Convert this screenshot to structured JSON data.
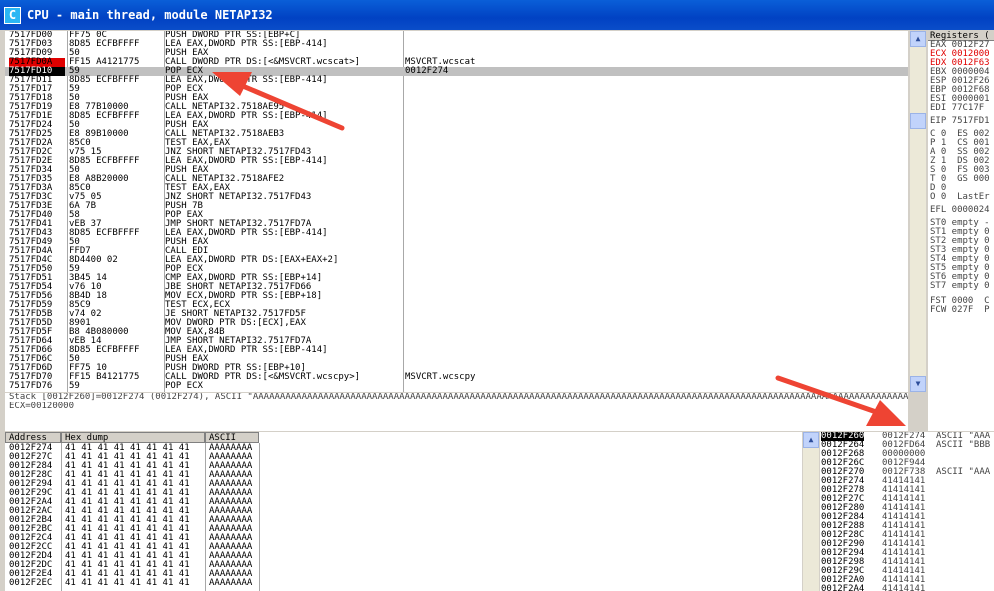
{
  "window": {
    "title": "CPU - main thread, module NETAPI32",
    "icon_letter": "C"
  },
  "cpu_rows": [
    {
      "addr": "7517FD00",
      "hex": "FF75 0C",
      "dis": "PUSH DWORD PTR SS:[EBP+C]",
      "com": ""
    },
    {
      "addr": "7517FD03",
      "hex": "8D85 ECFBFFFF",
      "dis": "LEA EAX,DWORD PTR SS:[EBP-414]",
      "com": ""
    },
    {
      "addr": "7517FD09",
      "hex": "50",
      "dis": "PUSH EAX",
      "com": ""
    },
    {
      "addr": "7517FD0A",
      "hex": "FF15 A4121775",
      "dis": "CALL DWORD PTR DS:[<&MSVCRT.wcscat>]",
      "com": "MSVCRT.wcscat",
      "state": "bp"
    },
    {
      "addr": "7517FD10",
      "hex": "59",
      "dis": "POP ECX",
      "com": "0012F274",
      "state": "cur"
    },
    {
      "addr": "7517FD11",
      "hex": "8D85 ECFBFFFF",
      "dis": "LEA EAX,DWORD PTR SS:[EBP-414]",
      "com": ""
    },
    {
      "addr": "7517FD17",
      "hex": "59",
      "dis": "POP ECX",
      "com": ""
    },
    {
      "addr": "7517FD18",
      "hex": "50",
      "dis": "PUSH EAX",
      "com": ""
    },
    {
      "addr": "7517FD19",
      "hex": "E8 77B10000",
      "dis": "CALL NETAPI32.7518AE95",
      "com": ""
    },
    {
      "addr": "7517FD1E",
      "hex": "8D85 ECFBFFFF",
      "dis": "LEA EAX,DWORD PTR SS:[EBP-414]",
      "com": ""
    },
    {
      "addr": "7517FD24",
      "hex": "50",
      "dis": "PUSH EAX",
      "com": ""
    },
    {
      "addr": "7517FD25",
      "hex": "E8 89B10000",
      "dis": "CALL NETAPI32.7518AEB3",
      "com": ""
    },
    {
      "addr": "7517FD2A",
      "hex": "85C0",
      "dis": "TEST EAX,EAX",
      "com": ""
    },
    {
      "addr": "7517FD2C",
      "hex": "v75 15",
      "dis": "JNZ SHORT NETAPI32.7517FD43",
      "com": ""
    },
    {
      "addr": "7517FD2E",
      "hex": "8D85 ECFBFFFF",
      "dis": "LEA EAX,DWORD PTR SS:[EBP-414]",
      "com": ""
    },
    {
      "addr": "7517FD34",
      "hex": "50",
      "dis": "PUSH EAX",
      "com": ""
    },
    {
      "addr": "7517FD35",
      "hex": "E8 A8B20000",
      "dis": "CALL NETAPI32.7518AFE2",
      "com": ""
    },
    {
      "addr": "7517FD3A",
      "hex": "85C0",
      "dis": "TEST EAX,EAX",
      "com": ""
    },
    {
      "addr": "7517FD3C",
      "hex": "v75 05",
      "dis": "JNZ SHORT NETAPI32.7517FD43",
      "com": ""
    },
    {
      "addr": "7517FD3E",
      "hex": "6A 7B",
      "dis": "PUSH 7B",
      "com": ""
    },
    {
      "addr": "7517FD40",
      "hex": "58",
      "dis": "POP EAX",
      "com": ""
    },
    {
      "addr": "7517FD41",
      "hex": "vEB 37",
      "dis": "JMP SHORT NETAPI32.7517FD7A",
      "com": ""
    },
    {
      "addr": "7517FD43",
      "hex": "8D85 ECFBFFFF",
      "dis": "LEA EAX,DWORD PTR SS:[EBP-414]",
      "com": ""
    },
    {
      "addr": "7517FD49",
      "hex": "50",
      "dis": "PUSH EAX",
      "com": ""
    },
    {
      "addr": "7517FD4A",
      "hex": "FFD7",
      "dis": "CALL EDI",
      "com": ""
    },
    {
      "addr": "7517FD4C",
      "hex": "8D4400 02",
      "dis": "LEA EAX,DWORD PTR DS:[EAX+EAX+2]",
      "com": ""
    },
    {
      "addr": "7517FD50",
      "hex": "59",
      "dis": "POP ECX",
      "com": ""
    },
    {
      "addr": "7517FD51",
      "hex": "3B45 14",
      "dis": "CMP EAX,DWORD PTR SS:[EBP+14]",
      "com": ""
    },
    {
      "addr": "7517FD54",
      "hex": "v76 10",
      "dis": "JBE SHORT NETAPI32.7517FD66",
      "com": ""
    },
    {
      "addr": "7517FD56",
      "hex": "8B4D 18",
      "dis": "MOV ECX,DWORD PTR SS:[EBP+18]",
      "com": ""
    },
    {
      "addr": "7517FD59",
      "hex": "85C9",
      "dis": "TEST ECX,ECX",
      "com": ""
    },
    {
      "addr": "7517FD5B",
      "hex": "v74 02",
      "dis": "JE SHORT NETAPI32.7517FD5F",
      "com": ""
    },
    {
      "addr": "7517FD5D",
      "hex": "8901",
      "dis": "MOV DWORD PTR DS:[ECX],EAX",
      "com": ""
    },
    {
      "addr": "7517FD5F",
      "hex": "B8 4B080000",
      "dis": "MOV EAX,84B",
      "com": ""
    },
    {
      "addr": "7517FD64",
      "hex": "vEB 14",
      "dis": "JMP SHORT NETAPI32.7517FD7A",
      "com": ""
    },
    {
      "addr": "7517FD66",
      "hex": "8D85 ECFBFFFF",
      "dis": "LEA EAX,DWORD PTR SS:[EBP-414]",
      "com": ""
    },
    {
      "addr": "7517FD6C",
      "hex": "50",
      "dis": "PUSH EAX",
      "com": ""
    },
    {
      "addr": "7517FD6D",
      "hex": "FF75 10",
      "dis": "PUSH DWORD PTR SS:[EBP+10]",
      "com": ""
    },
    {
      "addr": "7517FD70",
      "hex": "FF15 B4121775",
      "dis": "CALL DWORD PTR DS:[<&MSVCRT.wcscpy>]",
      "com": "MSVCRT.wcscpy"
    },
    {
      "addr": "7517FD76",
      "hex": "59",
      "dis": "POP ECX",
      "com": ""
    }
  ],
  "info": {
    "line1": "Stack [0012F260]=0012F274 (0012F274), ASCII \"AAAAAAAAAAAAAAAAAAAAAAAAAAAAAAAAAAAAAAAAAAAAAAAAAAAAAAAAAAAAAAAAAAAAAAAAAAAAAAAAAAAAAAAAAAAAAAAAAAAAAAAAAAAAAAAAAAAAAAAAAAAAAAAAAAAA",
    "line2": "ECX=00120000"
  },
  "dump": {
    "headers": {
      "address": "Address",
      "hex": "Hex dump",
      "ascii": "ASCII"
    },
    "rows": [
      {
        "addr": "0012F274",
        "hex": "41 41 41 41 41 41 41 41",
        "ascii": "AAAAAAAA"
      },
      {
        "addr": "0012F27C",
        "hex": "41 41 41 41 41 41 41 41",
        "ascii": "AAAAAAAA"
      },
      {
        "addr": "0012F284",
        "hex": "41 41 41 41 41 41 41 41",
        "ascii": "AAAAAAAA"
      },
      {
        "addr": "0012F28C",
        "hex": "41 41 41 41 41 41 41 41",
        "ascii": "AAAAAAAA"
      },
      {
        "addr": "0012F294",
        "hex": "41 41 41 41 41 41 41 41",
        "ascii": "AAAAAAAA"
      },
      {
        "addr": "0012F29C",
        "hex": "41 41 41 41 41 41 41 41",
        "ascii": "AAAAAAAA"
      },
      {
        "addr": "0012F2A4",
        "hex": "41 41 41 41 41 41 41 41",
        "ascii": "AAAAAAAA"
      },
      {
        "addr": "0012F2AC",
        "hex": "41 41 41 41 41 41 41 41",
        "ascii": "AAAAAAAA"
      },
      {
        "addr": "0012F2B4",
        "hex": "41 41 41 41 41 41 41 41",
        "ascii": "AAAAAAAA"
      },
      {
        "addr": "0012F2BC",
        "hex": "41 41 41 41 41 41 41 41",
        "ascii": "AAAAAAAA"
      },
      {
        "addr": "0012F2C4",
        "hex": "41 41 41 41 41 41 41 41",
        "ascii": "AAAAAAAA"
      },
      {
        "addr": "0012F2CC",
        "hex": "41 41 41 41 41 41 41 41",
        "ascii": "AAAAAAAA"
      },
      {
        "addr": "0012F2D4",
        "hex": "41 41 41 41 41 41 41 41",
        "ascii": "AAAAAAAA"
      },
      {
        "addr": "0012F2DC",
        "hex": "41 41 41 41 41 41 41 41",
        "ascii": "AAAAAAAA"
      },
      {
        "addr": "0012F2E4",
        "hex": "41 41 41 41 41 41 41 41",
        "ascii": "AAAAAAAA"
      },
      {
        "addr": "0012F2EC",
        "hex": "41 41 41 41 41 41 41 41",
        "ascii": "AAAAAAAA"
      }
    ]
  },
  "stack_rows": [
    {
      "addr": "0012F260",
      "val": "0012F274",
      "com": "ASCII \"AAA"
    },
    {
      "addr": "0012F264",
      "val": "0012FD64",
      "com": "ASCII \"BBB"
    },
    {
      "addr": "0012F268",
      "val": "00000000",
      "com": ""
    },
    {
      "addr": "0012F26C",
      "val": "0012F944",
      "com": ""
    },
    {
      "addr": "0012F270",
      "val": "0012F738",
      "com": "ASCII \"AAA"
    },
    {
      "addr": "0012F274",
      "val": "41414141",
      "com": ""
    },
    {
      "addr": "0012F278",
      "val": "41414141",
      "com": ""
    },
    {
      "addr": "0012F27C",
      "val": "41414141",
      "com": ""
    },
    {
      "addr": "0012F280",
      "val": "41414141",
      "com": ""
    },
    {
      "addr": "0012F284",
      "val": "41414141",
      "com": ""
    },
    {
      "addr": "0012F288",
      "val": "41414141",
      "com": ""
    },
    {
      "addr": "0012F28C",
      "val": "41414141",
      "com": ""
    },
    {
      "addr": "0012F290",
      "val": "41414141",
      "com": ""
    },
    {
      "addr": "0012F294",
      "val": "41414141",
      "com": ""
    },
    {
      "addr": "0012F298",
      "val": "41414141",
      "com": ""
    },
    {
      "addr": "0012F29C",
      "val": "41414141",
      "com": ""
    },
    {
      "addr": "0012F2A0",
      "val": "41414141",
      "com": ""
    },
    {
      "addr": "0012F2A4",
      "val": "41414141",
      "com": ""
    }
  ],
  "registers": {
    "title": "Registers (",
    "rows": [
      "EAX 0012F27",
      "ECX 0012000",
      "EDX 0012F63",
      "EBX 0000004",
      "ESP 0012F26",
      "EBP 0012F68",
      "ESI 0000001",
      "EDI 77C17F"
    ],
    "eip": "EIP 7517FD1",
    "flags": [
      "C 0  ES 002",
      "P 1  CS 001",
      "A 0  SS 002",
      "Z 1  DS 002",
      "S 0  FS 003",
      "T 0  GS 000",
      "D 0",
      "O 0  LastEr"
    ],
    "efl": "EFL 0000024",
    "fpu": [
      "ST0 empty -",
      "ST1 empty 0",
      "ST2 empty 0",
      "ST3 empty 0",
      "ST4 empty 0",
      "ST5 empty 0",
      "ST6 empty 0",
      "ST7 empty 0"
    ],
    "fst": "FST 0000  C",
    "fcw": "FCW 027F  P"
  },
  "colors": {
    "breakpoint": "#e00000",
    "annotation_arrow": "#ee4433",
    "title_blue": "#0a5fd8"
  }
}
